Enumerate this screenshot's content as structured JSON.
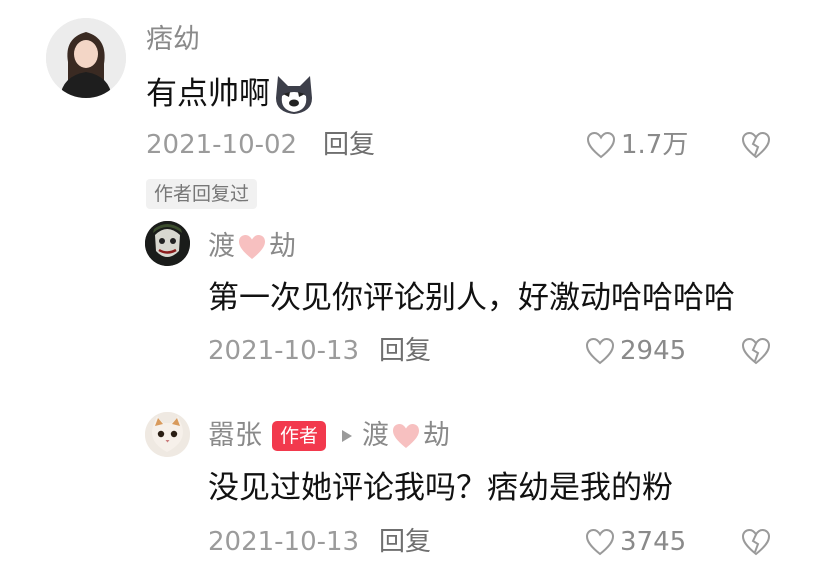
{
  "comments": [
    {
      "username": "痞幼",
      "text": "有点帅啊",
      "emoji_icon": "husky-dog-emoji-icon",
      "date": "2021-10-02",
      "reply_label": "回复",
      "likes": "1.7万",
      "author_replied_badge": "作者回复过"
    }
  ],
  "replies": [
    {
      "username_left": "渡",
      "username_right": "劫",
      "text": "第一次见你评论别人，好激动哈哈哈哈",
      "date": "2021-10-13",
      "reply_label": "回复",
      "likes": "2945"
    },
    {
      "username": "嚣张",
      "author_badge": "作者",
      "reply_to_left": "渡",
      "reply_to_right": "劫",
      "text": "没见过她评论我吗？痞幼是我的粉",
      "date": "2021-10-13",
      "reply_label": "回复",
      "likes": "3745"
    }
  ],
  "icons": {
    "like": "heart-outline-icon",
    "dislike": "broken-heart-icon",
    "name_heart": "pink-heart-icon",
    "reply_arrow": "triangle-right-icon"
  },
  "colors": {
    "author_badge": "#f2394d",
    "name_heart": "#f7c0c0"
  }
}
